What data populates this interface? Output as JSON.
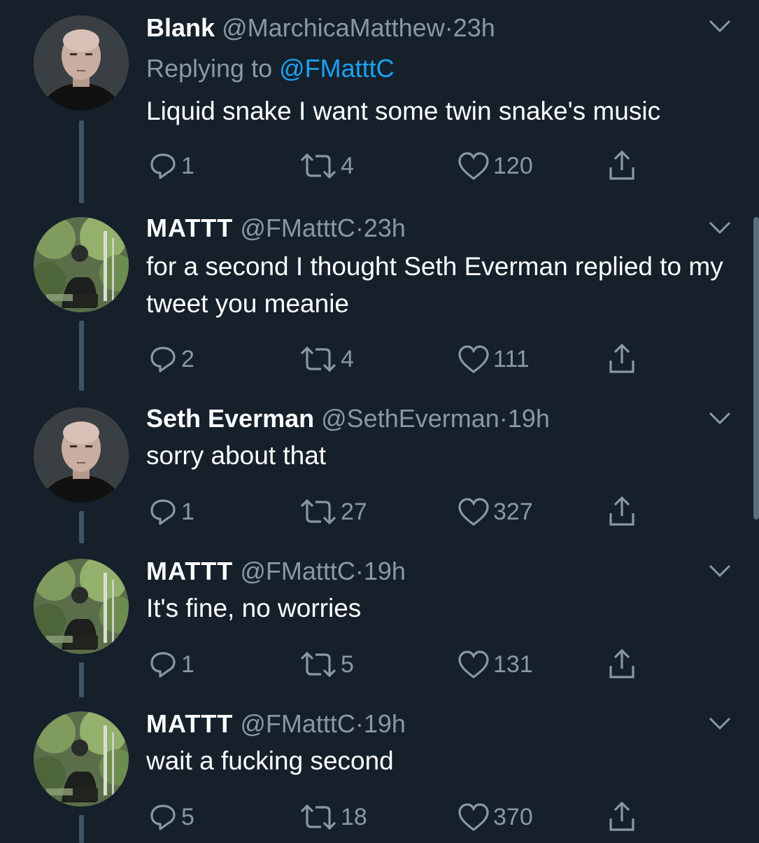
{
  "colors": {
    "background": "#15202b",
    "text": "#ffffff",
    "secondary": "#8899a6",
    "accent": "#1da1f2",
    "thread_line": "#3d5466"
  },
  "icons": {
    "reply": "reply-icon",
    "retweet": "retweet-icon",
    "like": "heart-icon",
    "share": "share-icon",
    "more": "chevron-down-icon"
  },
  "tweets": [
    {
      "name": "Blank",
      "handle": "@MarchicaMatthew",
      "separator": "·",
      "time": "23h",
      "replying_prefix": "Replying to",
      "replying_to": "@FMatttC",
      "text": "Liquid snake I want some twin snake's music",
      "replies": "1",
      "retweets": "4",
      "likes": "120"
    },
    {
      "name": "MATTT",
      "handle": "@FMatttC",
      "separator": "·",
      "time": "23h",
      "text": "for a second I thought Seth Everman replied to my tweet you meanie",
      "replies": "2",
      "retweets": "4",
      "likes": "111"
    },
    {
      "name": "Seth Everman",
      "handle": "@SethEverman",
      "separator": "·",
      "time": "19h",
      "text": "sorry about that",
      "replies": "1",
      "retweets": "27",
      "likes": "327"
    },
    {
      "name": "MATTT",
      "handle": "@FMatttC",
      "separator": "·",
      "time": "19h",
      "text": "It's fine, no worries",
      "replies": "1",
      "retweets": "5",
      "likes": "131"
    },
    {
      "name": "MATTT",
      "handle": "@FMatttC",
      "separator": "·",
      "time": "19h",
      "text": "wait a fucking second",
      "replies": "5",
      "retweets": "18",
      "likes": "370"
    }
  ]
}
